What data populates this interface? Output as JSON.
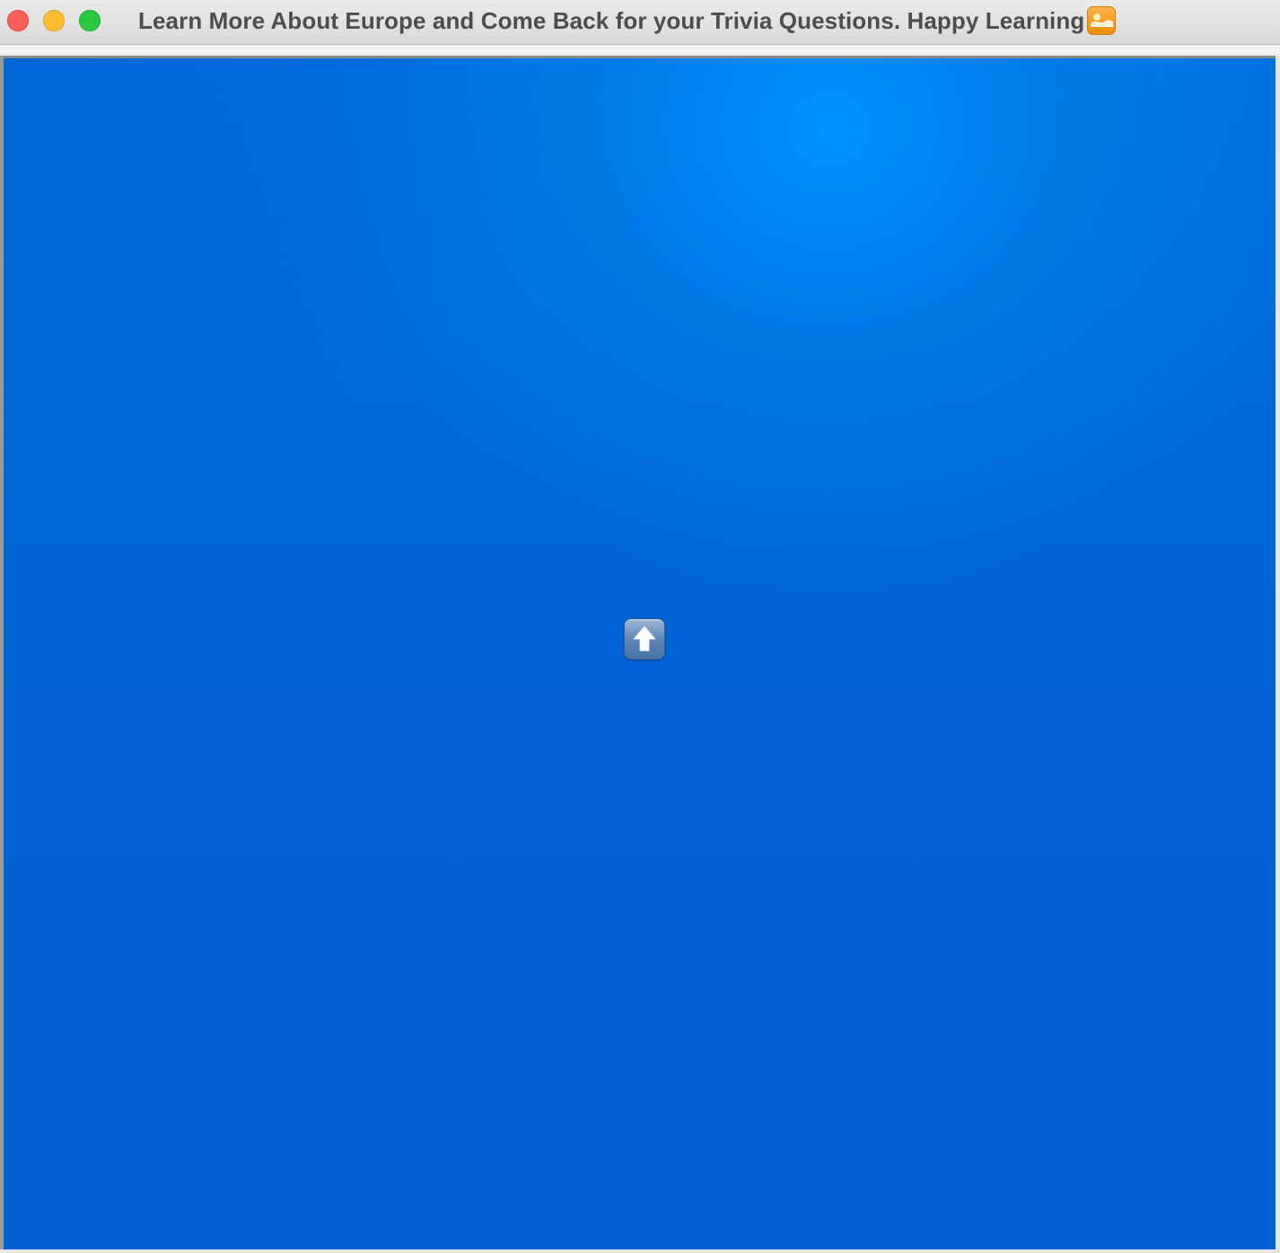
{
  "window": {
    "title": "Learn More About Europe and Come Back for your Trivia Questions. Happy Learning",
    "title_emoji": "sunrise-over-mountains-emoji",
    "traffic_lights": {
      "close": "#fe5f57",
      "minimize": "#febc2e",
      "maximize": "#28c840"
    }
  },
  "content": {
    "background_color": "#0062d6",
    "highlight_color": "#0090ff",
    "center_button": {
      "icon": "up-arrow-icon"
    }
  }
}
